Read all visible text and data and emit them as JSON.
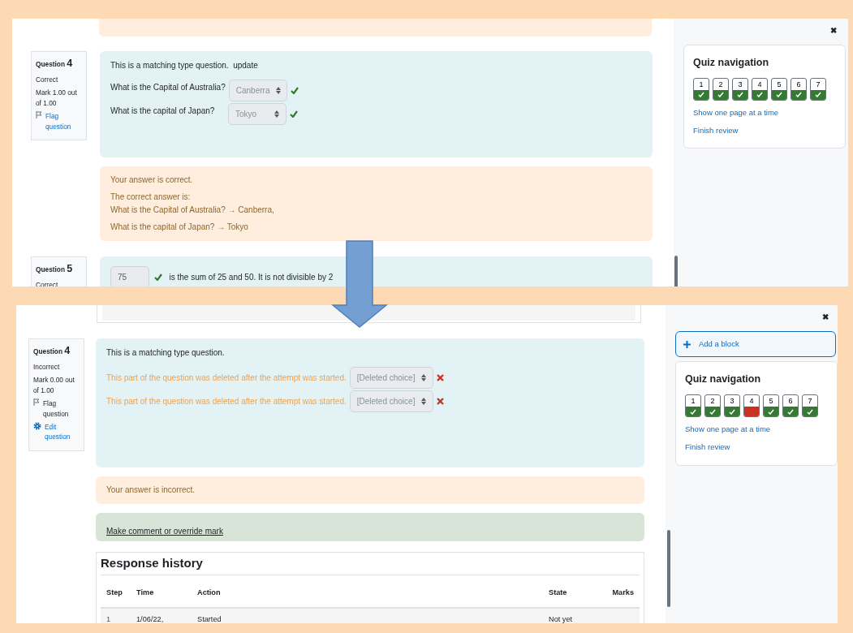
{
  "panels": [
    {
      "questions": [
        {
          "kind": "match",
          "label": "Question",
          "number": "4",
          "state": "Correct",
          "mark": "Mark 1.00 out of 1.00",
          "flag": "Flag question",
          "text": "This is a matching type question.  update",
          "items": [
            {
              "prompt": "What is the Capital of Australia?",
              "choice": "Canberra",
              "correct": true,
              "deleted": false
            },
            {
              "prompt": "What is the capital of Japan?",
              "choice": "Tokyo",
              "correct": true,
              "deleted": false
            }
          ],
          "feedback": [
            [
              "Your answer is correct."
            ],
            [
              "The correct answer is:",
              "What is the Capital of Australia? → Canberra,"
            ],
            [
              "What is the capital of Japan? → Tokyo"
            ]
          ]
        },
        {
          "kind": "numerical",
          "label": "Question",
          "number": "5",
          "state": "Correct",
          "answer": "75",
          "correct": true,
          "text": "is the sum of 25 and 50. It is not divisible by 2"
        }
      ],
      "drawer": {
        "close": "✖",
        "title": "Quiz navigation",
        "buttons": [
          {
            "label": "1",
            "correct": true
          },
          {
            "label": "2",
            "correct": true
          },
          {
            "label": "3",
            "correct": true
          },
          {
            "label": "4",
            "correct": true
          },
          {
            "label": "5",
            "correct": true
          },
          {
            "label": "6",
            "correct": true
          },
          {
            "label": "7",
            "correct": true
          }
        ],
        "links": [
          "Show one page at a time",
          "Finish review"
        ]
      }
    },
    {
      "questions": [
        {
          "kind": "match",
          "label": "Question",
          "number": "4",
          "state": "Incorrect",
          "mark": "Mark 0.00 out of 1.00",
          "flag": "Flag question",
          "edit": "Edit question",
          "text": "This is a matching type question.",
          "items": [
            {
              "prompt": "This part of the question was deleted after the attempt was started.",
              "choice": "[Deleted choice]",
              "correct": false,
              "deleted": true
            },
            {
              "prompt": "This part of the question was deleted after the attempt was started.",
              "choice": "[Deleted choice]",
              "correct": false,
              "deleted": true
            }
          ],
          "feedback": [
            [
              "Your answer is incorrect."
            ]
          ],
          "comment": "Make comment or override mark",
          "history": {
            "title": "Response history",
            "columns": [
              "Step",
              "Time",
              "Action",
              "State",
              "Marks"
            ],
            "rows": [
              {
                "step": "1",
                "time": "1/06/22,",
                "action": "Started",
                "state": "Not yet"
              }
            ]
          }
        }
      ],
      "drawer": {
        "close": "✖",
        "add_block": "Add a block",
        "title": "Quiz navigation",
        "buttons": [
          {
            "label": "1",
            "correct": true
          },
          {
            "label": "2",
            "correct": true
          },
          {
            "label": "3",
            "correct": true
          },
          {
            "label": "4",
            "correct": false
          },
          {
            "label": "5",
            "correct": true
          },
          {
            "label": "6",
            "correct": true
          },
          {
            "label": "7",
            "correct": true
          }
        ],
        "links": [
          "Show one page at a time",
          "Finish review"
        ]
      }
    }
  ]
}
